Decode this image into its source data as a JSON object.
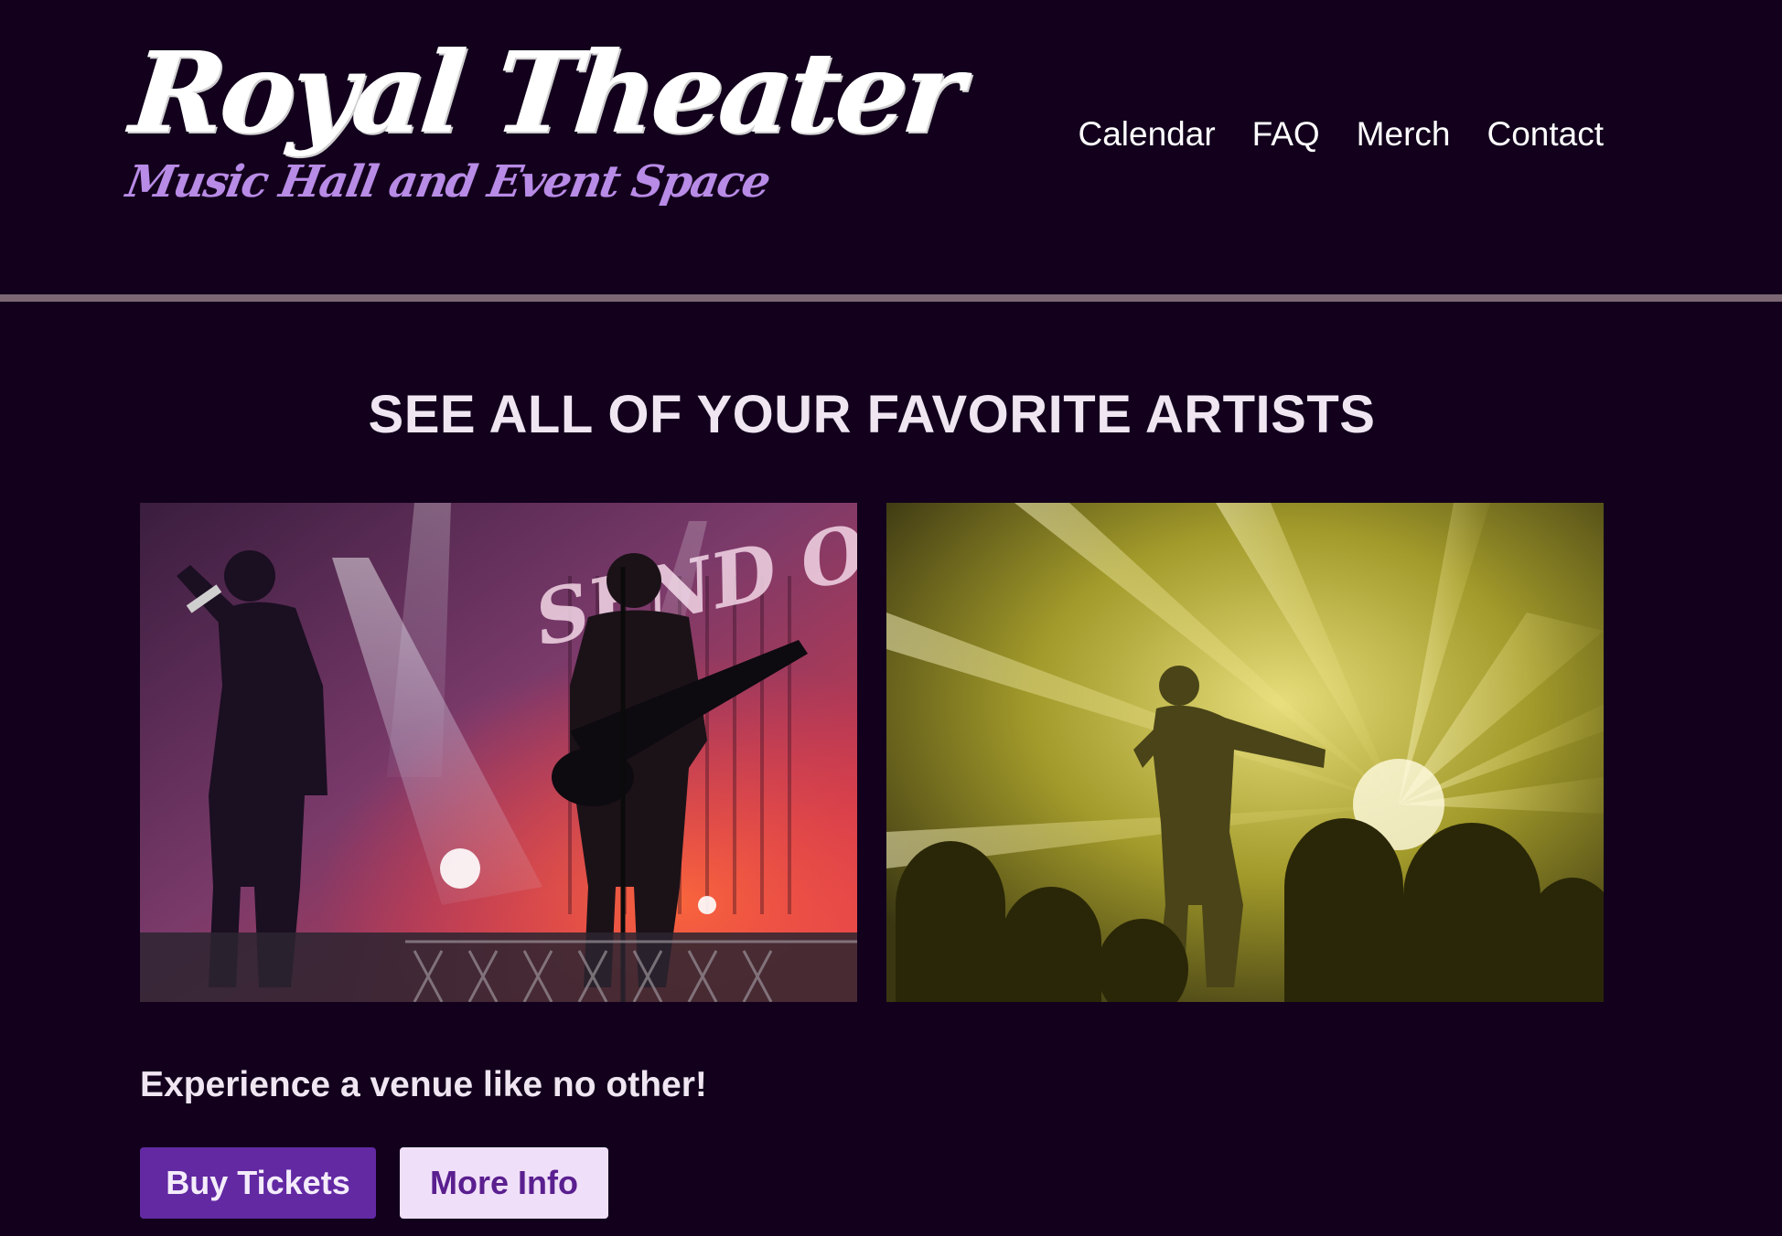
{
  "header": {
    "logo_title": "Royal Theater",
    "logo_subtitle": "Music Hall and Event Space",
    "nav": [
      {
        "label": "Calendar"
      },
      {
        "label": "FAQ"
      },
      {
        "label": "Merch"
      },
      {
        "label": "Contact"
      }
    ]
  },
  "main": {
    "heading": "SEE ALL OF YOUR FAVORITE ARTISTS",
    "photos": [
      {
        "subject": "rock-band-on-stage-photo",
        "banner_text": "SEND OFF"
      },
      {
        "subject": "singer-with-yellow-stage-lights-photo"
      }
    ],
    "tagline": "Experience a venue like no other!",
    "buy_tickets_label": "Buy Tickets",
    "more_info_label": "More Info"
  },
  "colors": {
    "background": "#12001c",
    "logo_subtitle": "#b88be6",
    "primary_button": "#6229a3",
    "secondary_button": "#f0dff9",
    "secondary_button_text": "#5a1f8f",
    "header_rule": "#7b6774"
  }
}
